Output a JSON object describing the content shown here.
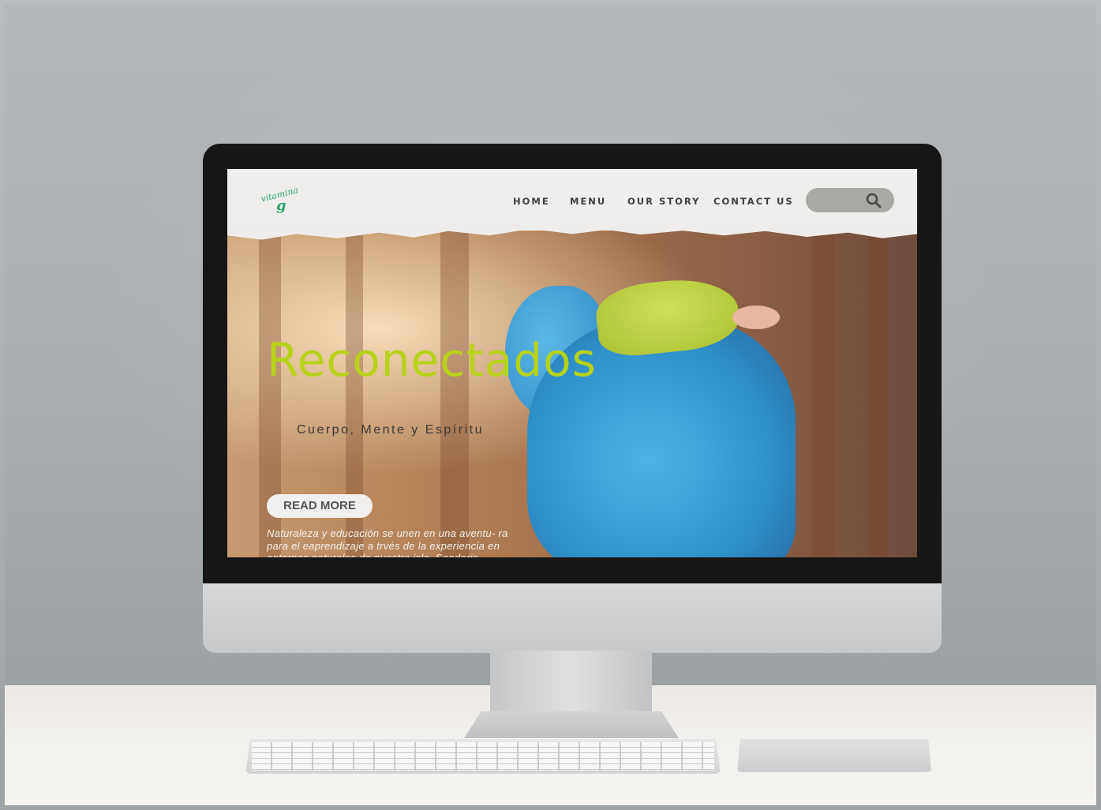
{
  "site": {
    "logo_text": "vitamina",
    "logo_letter": "g"
  },
  "nav": {
    "items": [
      {
        "label": "HOME"
      },
      {
        "label": "MENU"
      },
      {
        "label": "OUR STORY"
      },
      {
        "label": "CONTACT US"
      }
    ],
    "search_icon": "search-icon"
  },
  "hero": {
    "title": "Reconectados",
    "subtitle": "Cuerpo, Mente y Espíritu",
    "button_label": "READ MORE",
    "paragraph": "Naturaleza y educación se unen en una aventu- ra para el eaprendizaje a trvés de la experiencia en entornos naturales de nuestra isla. Senderis-"
  },
  "colors": {
    "title": "#b6d31a",
    "logo": "#2aa66a",
    "nav_text": "#3f3f3f",
    "search_bg": "#a9a9a6"
  }
}
